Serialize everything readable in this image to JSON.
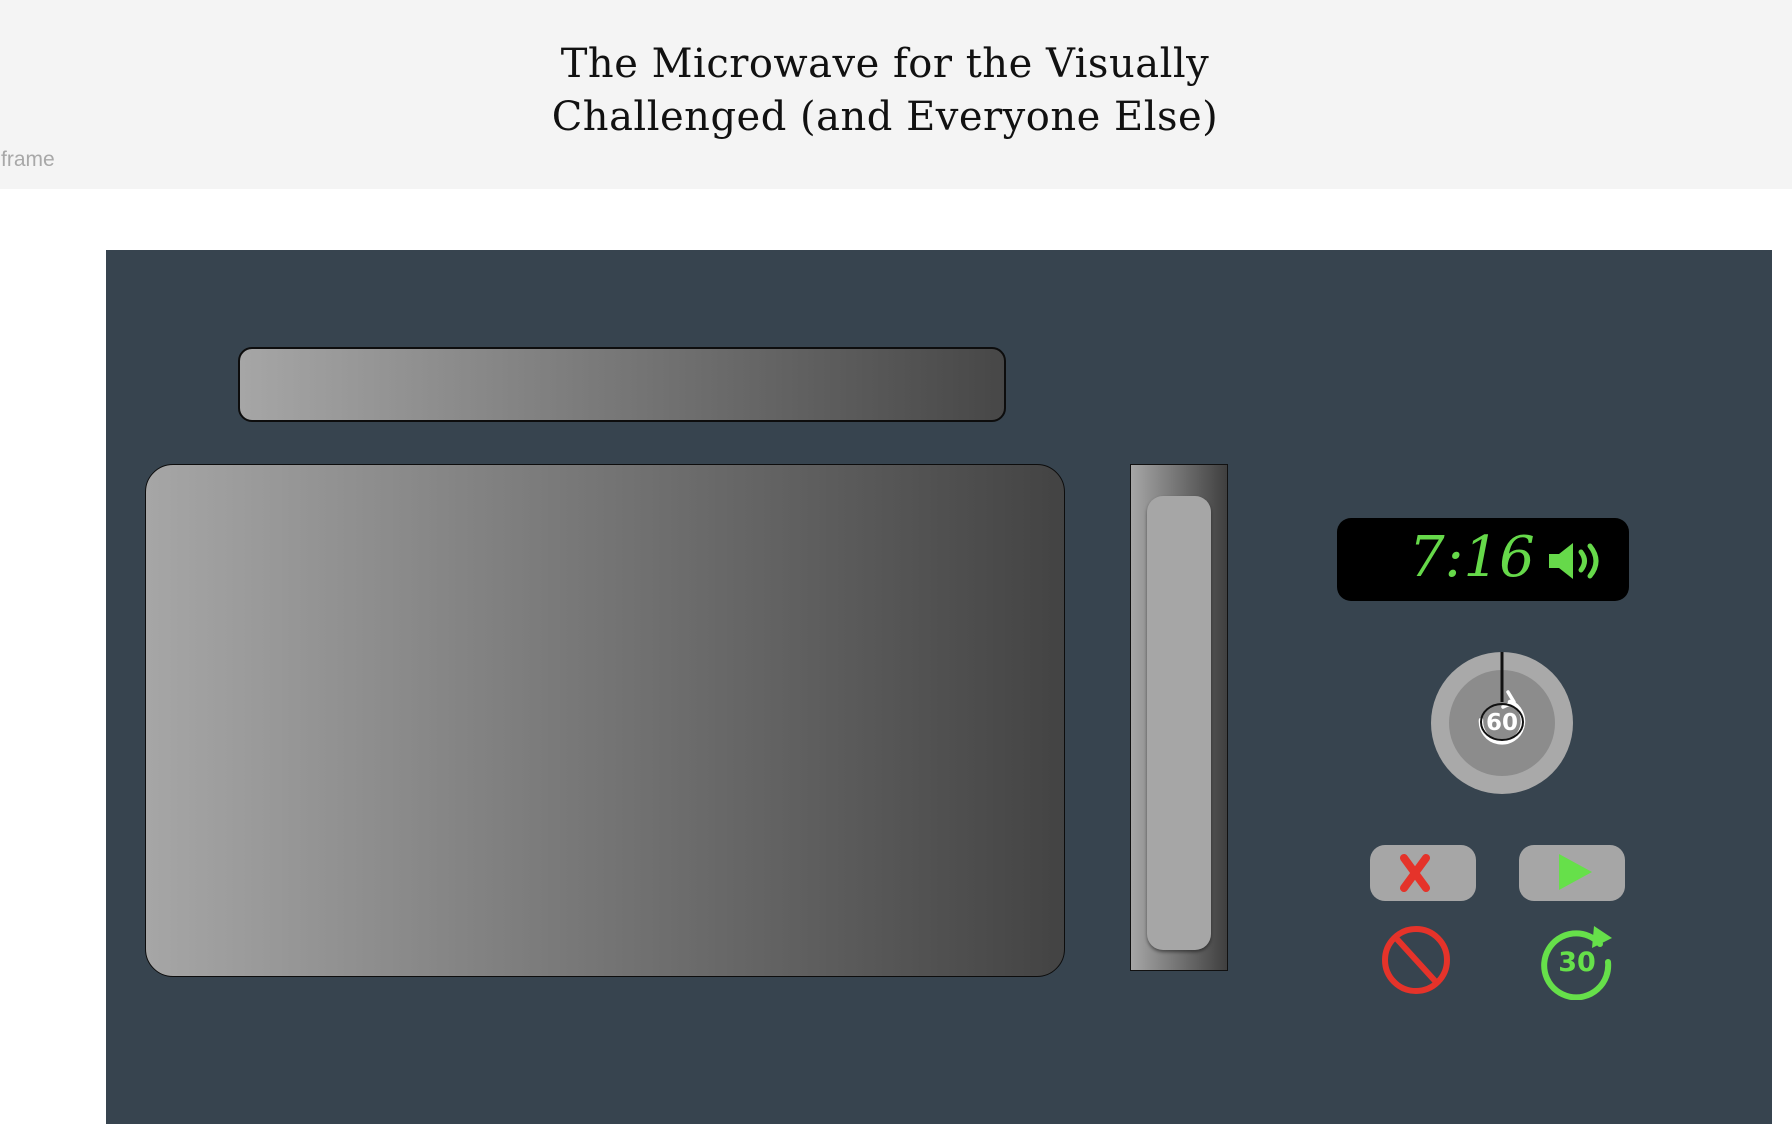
{
  "header": {
    "title_line1": "The Microwave for the Visually",
    "title_line2": "Challenged (and Everyone Else)",
    "frame_label": "frame"
  },
  "display": {
    "time": "7:16",
    "text_color": "#66d94a",
    "sound_icon": "speaker-volume-icon"
  },
  "dial": {
    "label": "60",
    "icon": "rotate-counterclockwise-icon"
  },
  "buttons": {
    "stop_icon": "x-mark-icon",
    "start_icon": "play-icon",
    "cancel_icon": "prohibited-icon",
    "add_time_label": "30",
    "add_time_icon": "rotate-clockwise-icon"
  },
  "colors": {
    "body": "#37444f",
    "header_bg": "#f4f4f4",
    "stop_red": "#e5332a",
    "start_green": "#66e04a"
  }
}
